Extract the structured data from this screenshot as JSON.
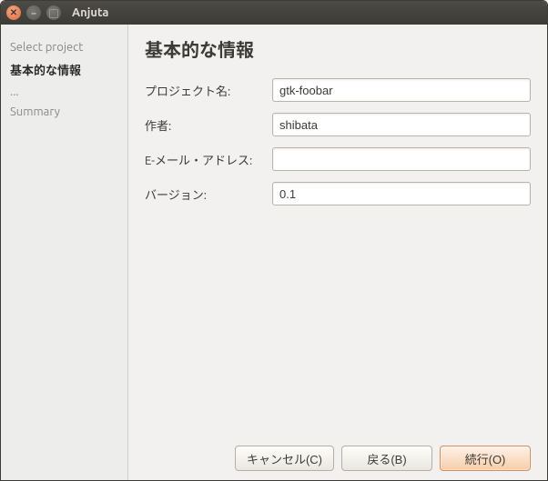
{
  "window": {
    "title": "Anjuta"
  },
  "sidebar": {
    "steps": [
      {
        "label": "Select project",
        "active": false
      },
      {
        "label": "基本的な情報",
        "active": true
      },
      {
        "label": "...",
        "active": false
      },
      {
        "label": "Summary",
        "active": false
      }
    ]
  },
  "page": {
    "heading": "基本的な情報",
    "fields": {
      "project_name": {
        "label": "プロジェクト名:",
        "value": "gtk-foobar"
      },
      "author": {
        "label": "作者:",
        "value": "shibata"
      },
      "email": {
        "label": "E-メール・アドレス:",
        "value": ""
      },
      "version": {
        "label": "バージョン:",
        "value": "0.1"
      }
    }
  },
  "buttons": {
    "cancel": "キャンセル(C)",
    "back": "戻る(B)",
    "continue": "続行(O)"
  }
}
